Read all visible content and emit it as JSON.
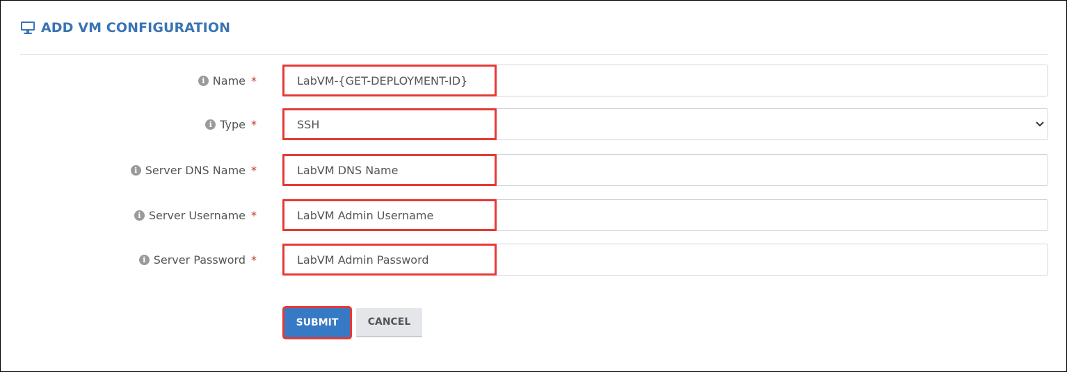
{
  "header": {
    "icon": "monitor-icon",
    "title": "ADD VM CONFIGURATION",
    "accent_color": "#3a74b3"
  },
  "form": {
    "fields": [
      {
        "label": "Name",
        "required_mark": "*",
        "value": "LabVM-{GET-DEPLOYMENT-ID}",
        "control": "text"
      },
      {
        "label": "Type",
        "required_mark": "*",
        "value": "SSH",
        "control": "select"
      },
      {
        "label": "Server DNS Name",
        "required_mark": "*",
        "value": "LabVM DNS Name",
        "control": "text"
      },
      {
        "label": "Server Username",
        "required_mark": "*",
        "value": "LabVM Admin Username",
        "control": "text"
      },
      {
        "label": "Server Password",
        "required_mark": "*",
        "value": "LabVM Admin Password",
        "control": "text"
      }
    ],
    "highlight_color": "#e53935",
    "required_color": "#c0392b"
  },
  "actions": {
    "submit_label": "SUBMIT",
    "cancel_label": "CANCEL",
    "submit_color": "#3679c5"
  }
}
